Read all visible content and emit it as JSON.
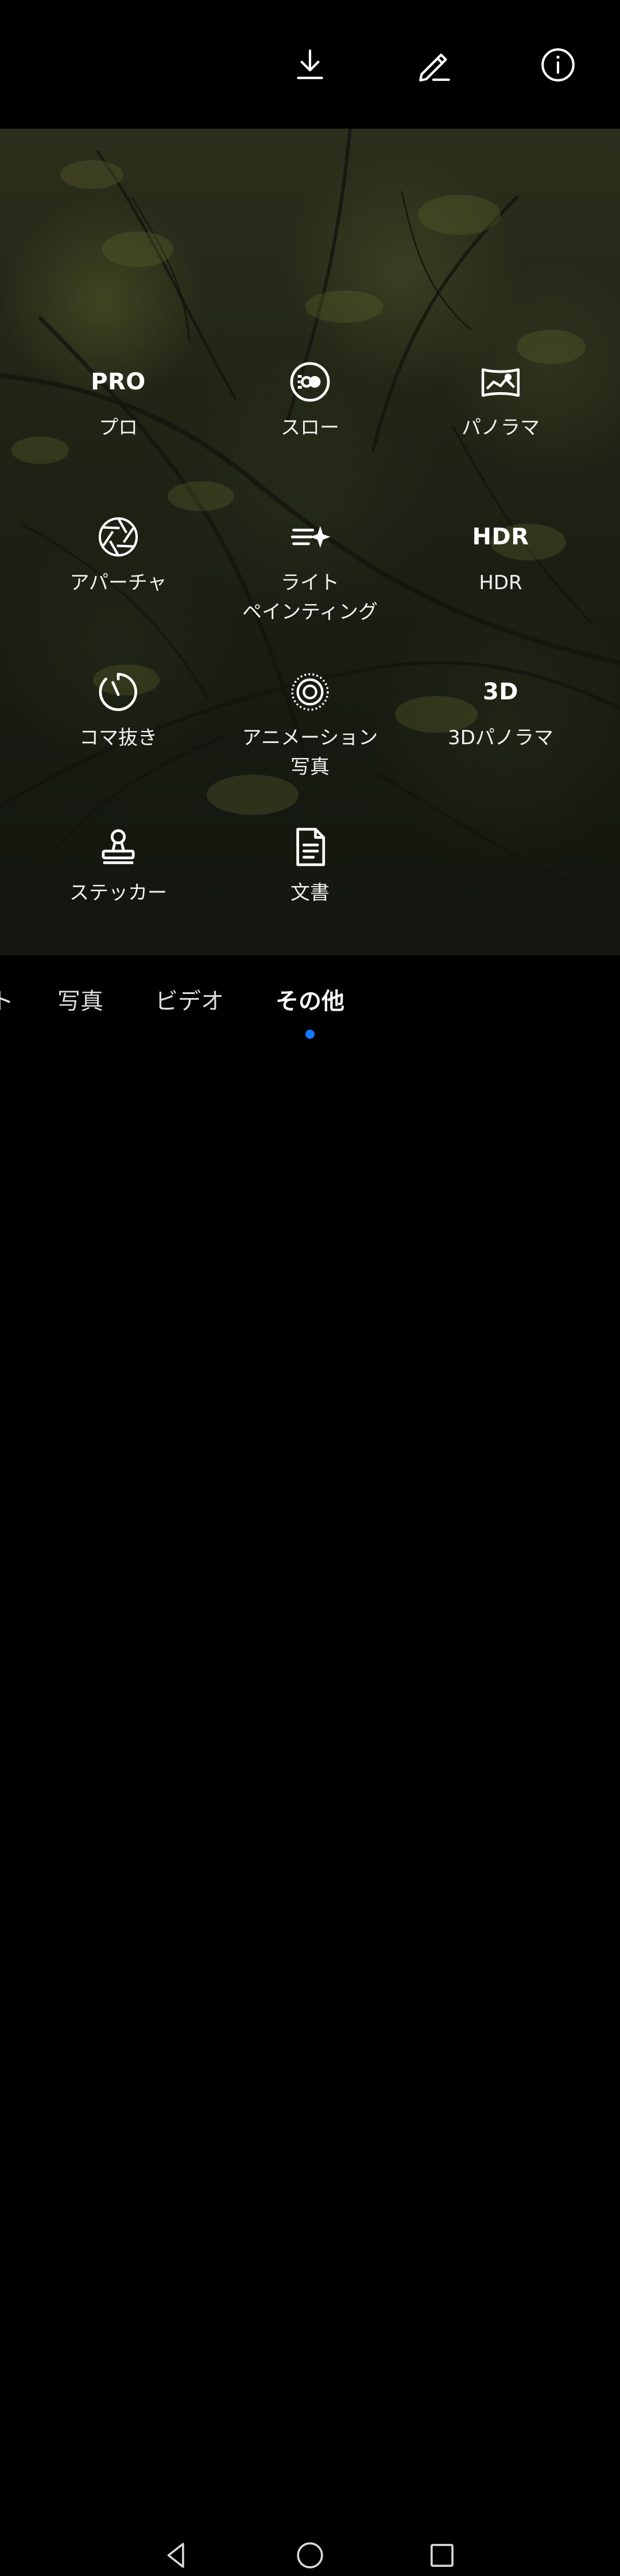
{
  "top_bar": {
    "icons": [
      {
        "name": "download-icon"
      },
      {
        "name": "edit-icon"
      },
      {
        "name": "info-icon"
      }
    ]
  },
  "modes": [
    {
      "icon": "pro-text-icon",
      "icon_text": "PRO",
      "label": "プロ"
    },
    {
      "icon": "slow-motion-icon",
      "label": "スロー"
    },
    {
      "icon": "panorama-icon",
      "label": "パノラマ"
    },
    {
      "icon": "aperture-icon",
      "label": "アパーチャ"
    },
    {
      "icon": "light-painting-icon",
      "label": "ライト\nペインティング"
    },
    {
      "icon": "hdr-text-icon",
      "icon_text": "HDR",
      "label": "HDR"
    },
    {
      "icon": "time-lapse-icon",
      "label": "コマ抜き"
    },
    {
      "icon": "animation-photo-icon",
      "label": "アニメーション\n写真"
    },
    {
      "icon": "3d-panorama-icon",
      "icon_text": "3D",
      "label": "3Dパノラマ"
    },
    {
      "icon": "sticker-icon",
      "label": "ステッカー"
    },
    {
      "icon": "document-icon",
      "label": "文書"
    }
  ],
  "tabs": [
    {
      "label": "ト"
    },
    {
      "label": "写真"
    },
    {
      "label": "ビデオ"
    },
    {
      "label": "その他",
      "active": true
    }
  ],
  "nav_bar": {
    "buttons": [
      {
        "name": "back-icon"
      },
      {
        "name": "home-icon"
      },
      {
        "name": "recents-icon"
      }
    ]
  },
  "colors": {
    "active_indicator": "#1479ff",
    "background": "#000000",
    "text": "#ffffff"
  }
}
